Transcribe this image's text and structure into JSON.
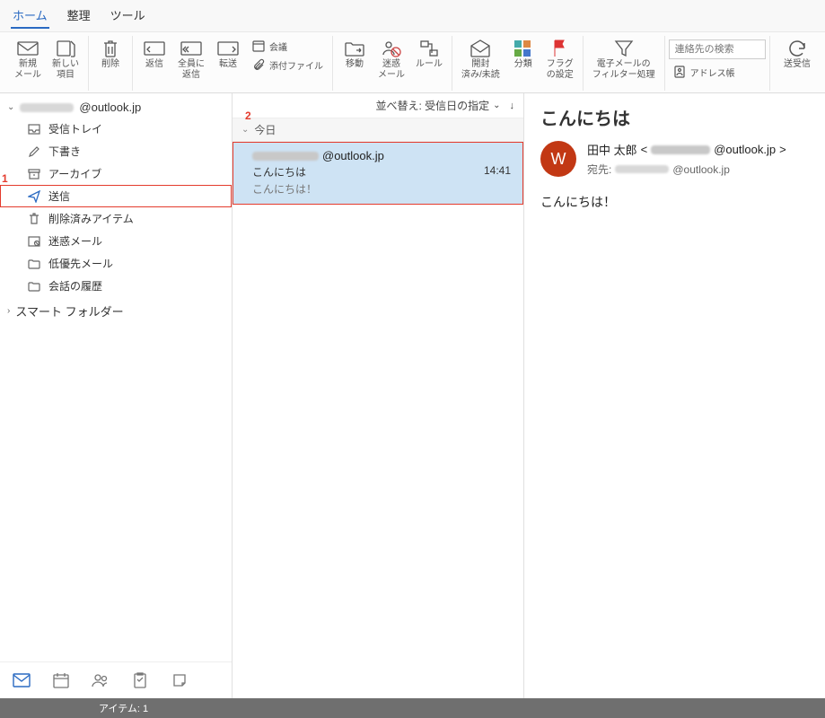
{
  "menu": {
    "home": "ホーム",
    "organize": "整理",
    "tools": "ツール"
  },
  "ribbon": {
    "new_mail": "新規\nメール",
    "new_item": "新しい\n項目",
    "delete": "削除",
    "reply": "返信",
    "reply_all": "全員に\n返信",
    "forward": "転送",
    "meeting": "会議",
    "attach": "添付ファイル",
    "move": "移動",
    "junk": "迷惑\nメール",
    "rules": "ルール",
    "mark_read": "開封\n済み/未読",
    "categorize": "分類",
    "flag": "フラグ\nの設定",
    "filter": "電子メールの\nフィルター処理",
    "search_placeholder": "連絡先の検索",
    "address_book": "アドレス帳",
    "send_receive": "送受信"
  },
  "sidebar": {
    "account_suffix": "@outlook.jp",
    "folders": [
      {
        "key": "inbox",
        "label": "受信トレイ"
      },
      {
        "key": "drafts",
        "label": "下書き"
      },
      {
        "key": "archive",
        "label": "アーカイブ"
      },
      {
        "key": "sent",
        "label": "送信"
      },
      {
        "key": "deleted",
        "label": "削除済みアイテム"
      },
      {
        "key": "junk",
        "label": "迷惑メール"
      },
      {
        "key": "clutter",
        "label": "低優先メール"
      },
      {
        "key": "history",
        "label": "会話の履歴"
      }
    ],
    "smart_folders": "スマート フォルダー"
  },
  "msglist": {
    "sort_label": "並べ替え: 受信日の指定",
    "group_today": "今日",
    "items": [
      {
        "from_suffix": "@outlook.jp",
        "subject": "こんにちは",
        "time": "14:41",
        "preview": "こんにちは！"
      }
    ]
  },
  "reading": {
    "subject": "こんにちは",
    "avatar_initial": "W",
    "sender_name": "田中 太郎",
    "sender_email_suffix": "@outlook.jp",
    "to_label": "宛先:",
    "to_suffix": "@outlook.jp",
    "body": "こんにちは！"
  },
  "status": {
    "items": "アイテム: 1"
  },
  "annotations": {
    "a1": "1",
    "a2": "2"
  }
}
